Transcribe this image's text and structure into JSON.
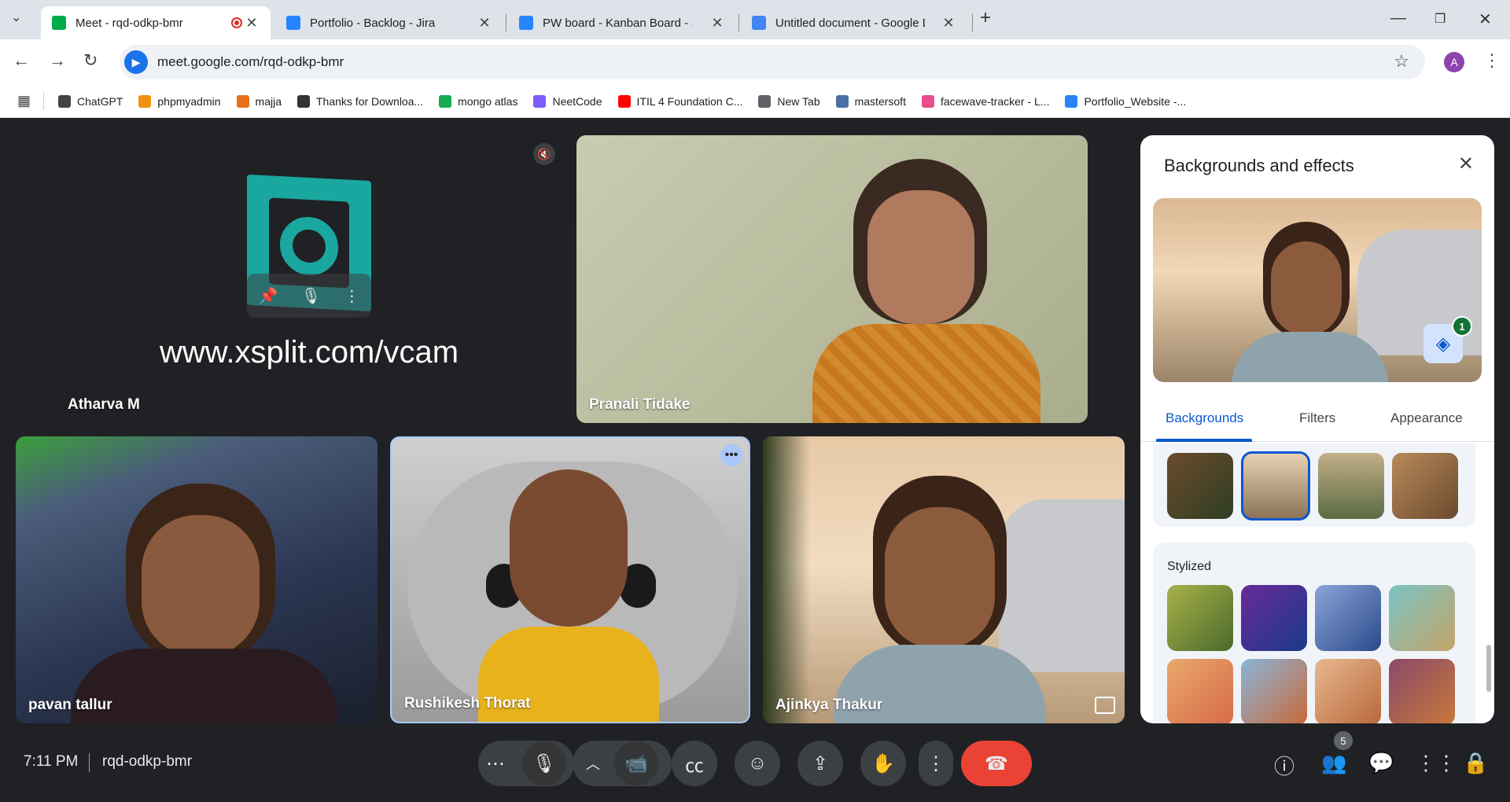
{
  "browser": {
    "tabs": [
      {
        "title": "Meet - rqd-odkp-bmr",
        "active": true,
        "icon": "meet-icon"
      },
      {
        "title": "Portfolio - Backlog - Jira",
        "icon": "jira-icon"
      },
      {
        "title": "PW board - Kanban Board - Jira",
        "icon": "jira-icon"
      },
      {
        "title": "Untitled document - Google Do",
        "icon": "docs-icon"
      }
    ],
    "new_tab": "+",
    "url": "meet.google.com/rqd-odkp-bmr",
    "profile_initial": "A",
    "bookmarks": [
      {
        "label": "ChatGPT",
        "color": "#444444"
      },
      {
        "label": "phpmyadmin",
        "color": "#f29111"
      },
      {
        "label": "majja",
        "color": "#e8711a"
      },
      {
        "label": "Thanks for Downloa...",
        "color": "#333333"
      },
      {
        "label": "mongo atlas",
        "color": "#13aa52"
      },
      {
        "label": "NeetCode",
        "color": "#7b5cff"
      },
      {
        "label": "ITIL 4 Foundation C...",
        "color": "#ff0000"
      },
      {
        "label": "New Tab",
        "color": "#5f6368"
      },
      {
        "label": "mastersoft",
        "color": "#4a6fa5"
      },
      {
        "label": "facewave-tracker - L...",
        "color": "#e94d8a"
      },
      {
        "label": "Portfolio_Website -...",
        "color": "#2684ff"
      }
    ]
  },
  "participants": [
    {
      "name": "Atharva M",
      "overlay_text": "www.xsplit.com/vcam"
    },
    {
      "name": "Pranali Tidake"
    },
    {
      "name": "pavan tallur"
    },
    {
      "name": "Rushikesh Thorat"
    },
    {
      "name": "Ajinkya Thakur"
    }
  ],
  "panel": {
    "title": "Backgrounds and effects",
    "badge": "1",
    "tabs": [
      "Backgrounds",
      "Filters",
      "Appearance"
    ],
    "active_tab": "Backgrounds",
    "section_label": "Stylized"
  },
  "bottom": {
    "time": "7:11 PM",
    "meeting_code": "rqd-odkp-bmr",
    "people_count": "5"
  },
  "colors": {
    "accent": "#1a73e8",
    "end_call": "#ea4335",
    "bg": "#202124"
  }
}
